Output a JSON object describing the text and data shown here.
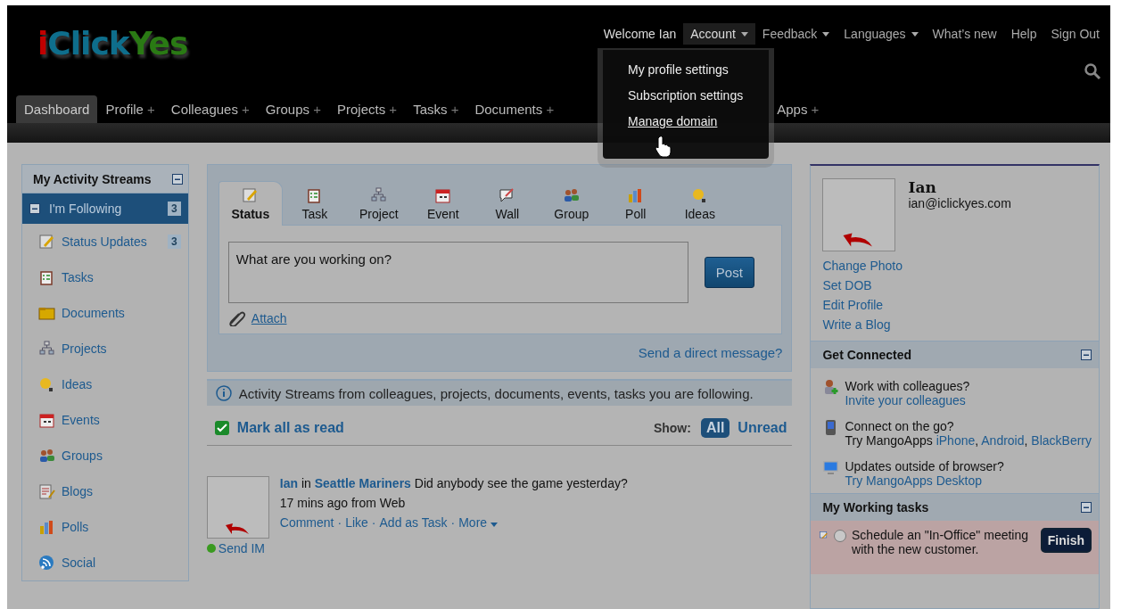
{
  "logo": [
    {
      "text": "i",
      "color": "#c00000"
    },
    {
      "text": "Click",
      "color": "#0e6e8c"
    },
    {
      "text": "Yes",
      "color": "#2a7a14"
    }
  ],
  "top_links": [
    {
      "label": "Welcome  Ian",
      "kind": "text",
      "dropdown": false,
      "selected": false
    },
    {
      "label": "Account",
      "kind": "link",
      "dropdown": true,
      "selected": true
    },
    {
      "label": "Feedback",
      "kind": "link",
      "dropdown": true,
      "selected": false
    },
    {
      "label": "Languages",
      "kind": "link",
      "dropdown": true,
      "selected": false
    },
    {
      "label": "What’s new",
      "kind": "link",
      "dropdown": false,
      "selected": false
    },
    {
      "label": "Help",
      "kind": "link",
      "dropdown": false,
      "selected": false
    },
    {
      "label": "Sign Out",
      "kind": "link",
      "dropdown": false,
      "selected": false
    }
  ],
  "account_menu": [
    {
      "label": "My profile settings",
      "hovered": false
    },
    {
      "label": "Subscription settings",
      "hovered": false
    },
    {
      "label": "Manage domain",
      "hovered": true
    }
  ],
  "nav": [
    {
      "label": "Dashboard",
      "selected": true
    },
    {
      "label": "Profile",
      "selected": false,
      "suffix": "+"
    },
    {
      "label": "Colleagues",
      "selected": false,
      "suffix": "+"
    },
    {
      "label": "Groups",
      "selected": false,
      "suffix": "+"
    },
    {
      "label": "Projects",
      "selected": false,
      "suffix": "+"
    },
    {
      "label": "Tasks",
      "selected": false,
      "suffix": "+"
    },
    {
      "label": "Documents",
      "selected": false,
      "suffix": "+"
    },
    {
      "label": "Apps",
      "selected": false,
      "suffix": "+"
    }
  ],
  "sidebar": {
    "title": "My Activity Streams",
    "items": [
      {
        "label": "I'm Following",
        "count": "3",
        "selected": true,
        "expanded": true,
        "children": [
          {
            "label": "Status Updates",
            "count": "3"
          },
          {
            "label": "Tasks"
          },
          {
            "label": "Documents"
          },
          {
            "label": "Projects"
          },
          {
            "label": "Ideas"
          },
          {
            "label": "Events"
          },
          {
            "label": "Groups"
          },
          {
            "label": "Blogs"
          },
          {
            "label": "Polls"
          },
          {
            "label": "Social"
          }
        ]
      }
    ]
  },
  "composer": {
    "tabs": [
      {
        "label": "Status",
        "selected": true
      },
      {
        "label": "Task",
        "selected": false
      },
      {
        "label": "Project",
        "selected": false
      },
      {
        "label": "Event",
        "selected": false
      },
      {
        "label": "Wall",
        "selected": false
      },
      {
        "label": "Group",
        "selected": false
      },
      {
        "label": "Poll",
        "selected": false
      },
      {
        "label": "Ideas",
        "selected": false
      }
    ],
    "placeholder": "What are you working on?",
    "post": "Post",
    "attach": "Attach",
    "direct_message": "Send a direct message?"
  },
  "info": "Activity Streams from colleagues, projects, documents, events, tasks you are following.",
  "feed": {
    "mark_all": "Mark all as read",
    "show_label": "Show:",
    "filters": [
      {
        "label": "All",
        "selected": true
      },
      {
        "label": "Unread",
        "selected": false
      }
    ],
    "posts": [
      {
        "author": "Ian",
        "in": "in",
        "group": "Seattle Mariners",
        "text": "Did anybody see the game yesterday?",
        "time": "17 mins ago from Web",
        "actions": [
          "Comment",
          "Like",
          "Add as Task",
          "More"
        ],
        "separator": "·",
        "send_im": "Send IM",
        "online": true
      }
    ]
  },
  "profile": {
    "name": "Ian",
    "email": "ian@iclickyes.com",
    "links": [
      "Change Photo",
      "Set DOB",
      "Edit Profile",
      "Write a Blog"
    ]
  },
  "get_connected": {
    "title": "Get Connected",
    "items": [
      {
        "question": "Work with colleagues?",
        "links": [
          "Invite your colleagues"
        ]
      },
      {
        "question": "Connect on the go?",
        "prefix": "Try MangoApps",
        "links": [
          "iPhone",
          "Android",
          "BlackBerry"
        ],
        "separator": ","
      },
      {
        "question": "Updates outside of browser?",
        "links": [
          "Try MangoApps Desktop"
        ]
      }
    ]
  },
  "working_tasks": {
    "title": "My Working tasks",
    "items": [
      {
        "text": "Schedule an \"In-Office\" meeting with the new customer.",
        "done": false,
        "action": "Finish"
      }
    ]
  }
}
